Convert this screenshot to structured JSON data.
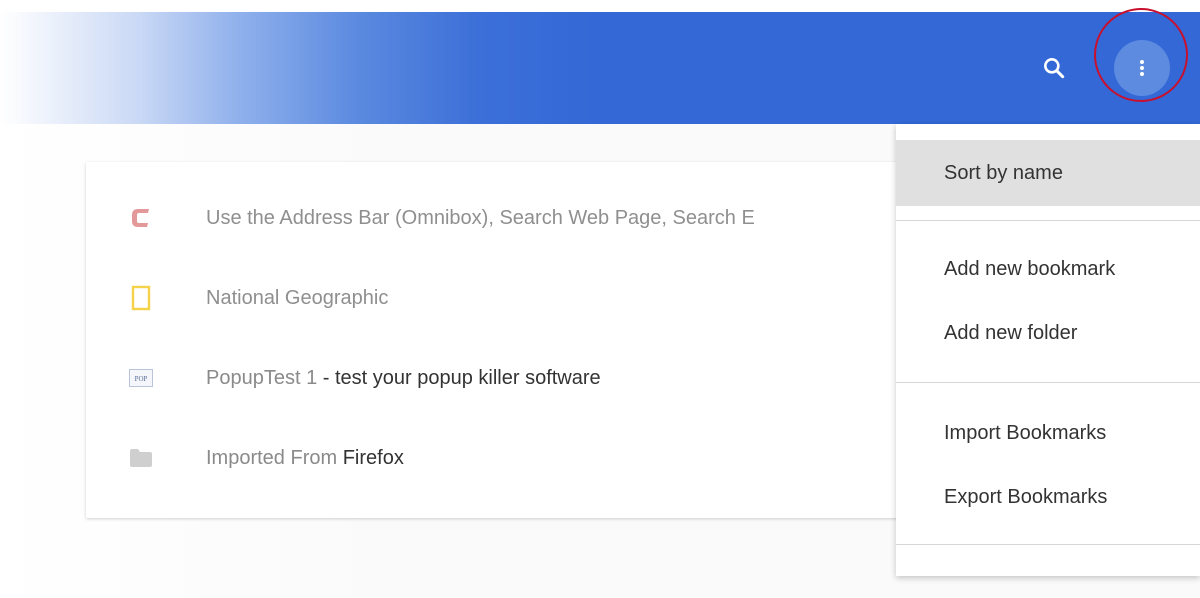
{
  "toolbar": {
    "accent_color": "#3368d6",
    "search_icon": "search-icon",
    "more_icon": "more-vert-icon",
    "annotation_color": "#c8102e"
  },
  "bookmarks": [
    {
      "icon": "comodo-c-icon",
      "title": "Use the Address Bar (Omnibox), Search Web Page, Search E"
    },
    {
      "icon": "national-geographic-icon",
      "title": "National Geographic"
    },
    {
      "icon": "popup-test-icon",
      "icon_label": "POP",
      "title_prefix": "PopupTest 1",
      "title_suffix": " - test your popup killer software"
    },
    {
      "icon": "folder-icon",
      "title_prefix": "Imported From ",
      "title_suffix": "Firefox"
    }
  ],
  "menu": {
    "sort_by_name": "Sort by name",
    "add_new_bookmark": "Add new bookmark",
    "add_new_folder": "Add new folder",
    "import_bookmarks": "Import Bookmarks",
    "export_bookmarks": "Export Bookmarks"
  }
}
